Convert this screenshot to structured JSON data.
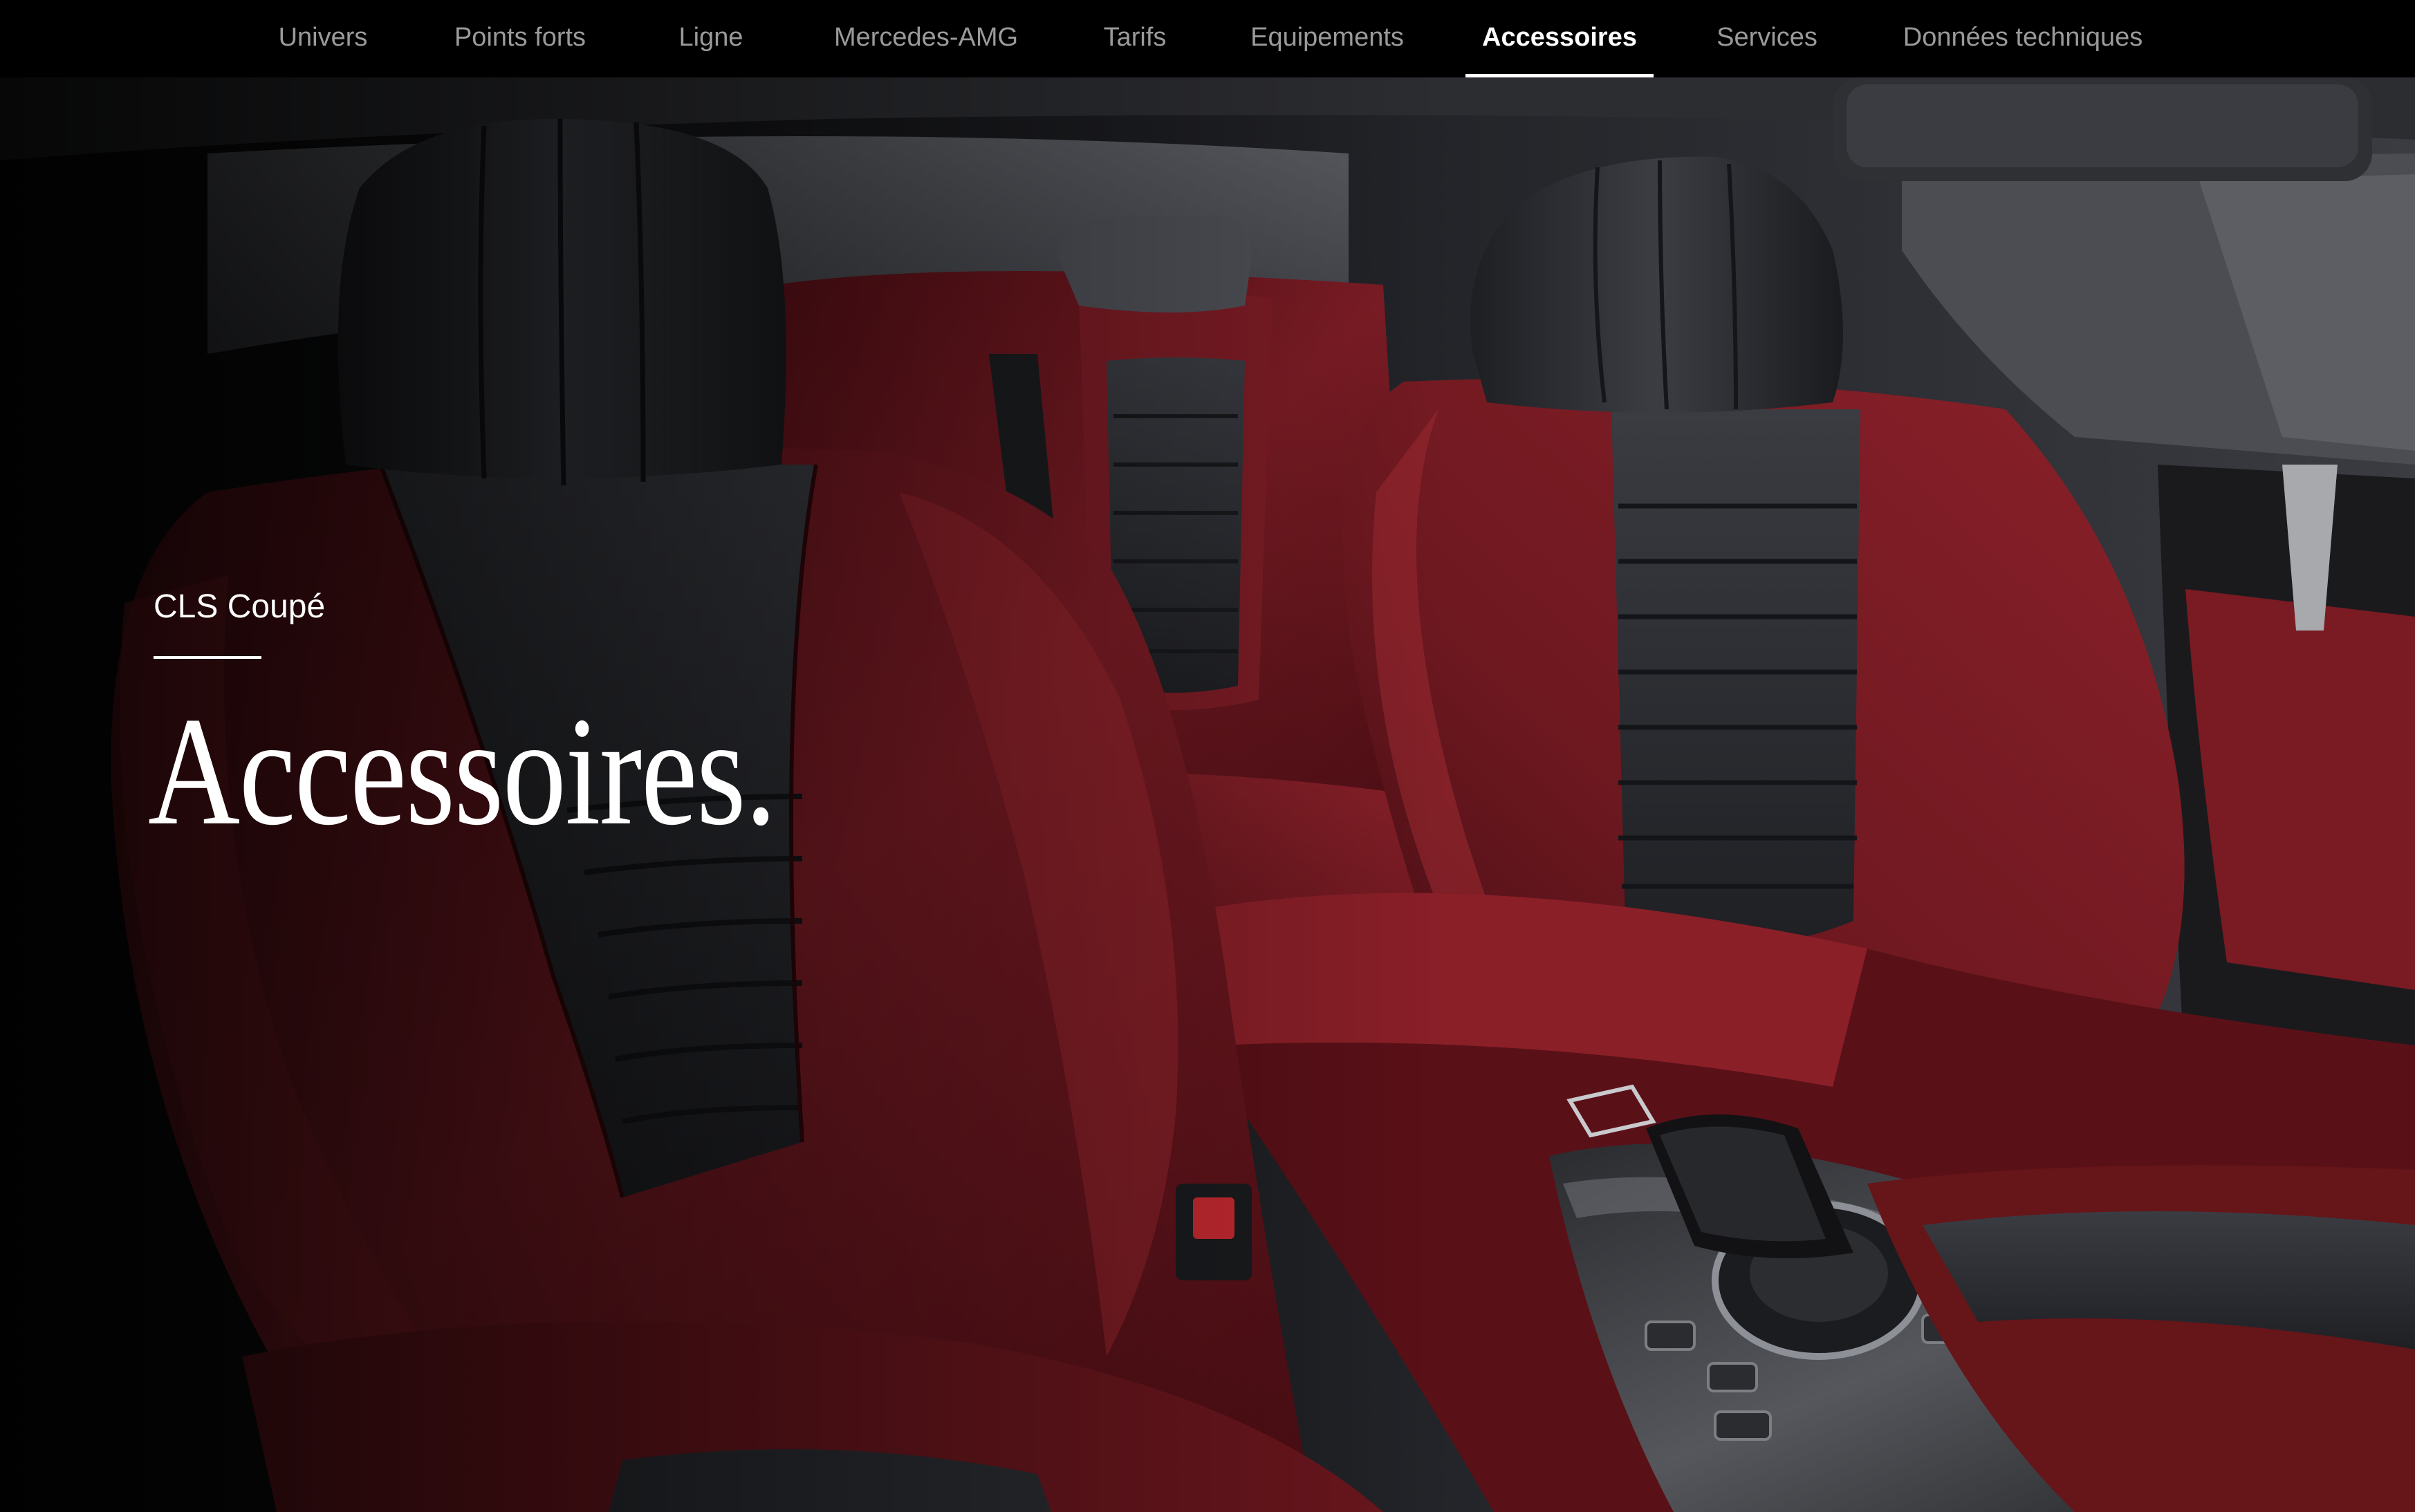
{
  "nav": {
    "items": [
      {
        "label": "Univers",
        "active": false
      },
      {
        "label": "Points forts",
        "active": false
      },
      {
        "label": "Ligne",
        "active": false
      },
      {
        "label": "Mercedes-AMG",
        "active": false
      },
      {
        "label": "Tarifs",
        "active": false
      },
      {
        "label": "Equipements",
        "active": false
      },
      {
        "label": "Accessoires",
        "active": true
      },
      {
        "label": "Services",
        "active": false
      },
      {
        "label": "Données techniques",
        "active": false
      }
    ]
  },
  "hero": {
    "model_name": "CLS Coupé",
    "heading": "Accessoires.",
    "image": "car-interior-red-black-leather-seats"
  },
  "colors": {
    "nav_background": "#000000",
    "nav_text": "#9a9a9a",
    "nav_active": "#ffffff",
    "leather_red": "#7a1a22",
    "leather_black": "#2a2c31"
  }
}
